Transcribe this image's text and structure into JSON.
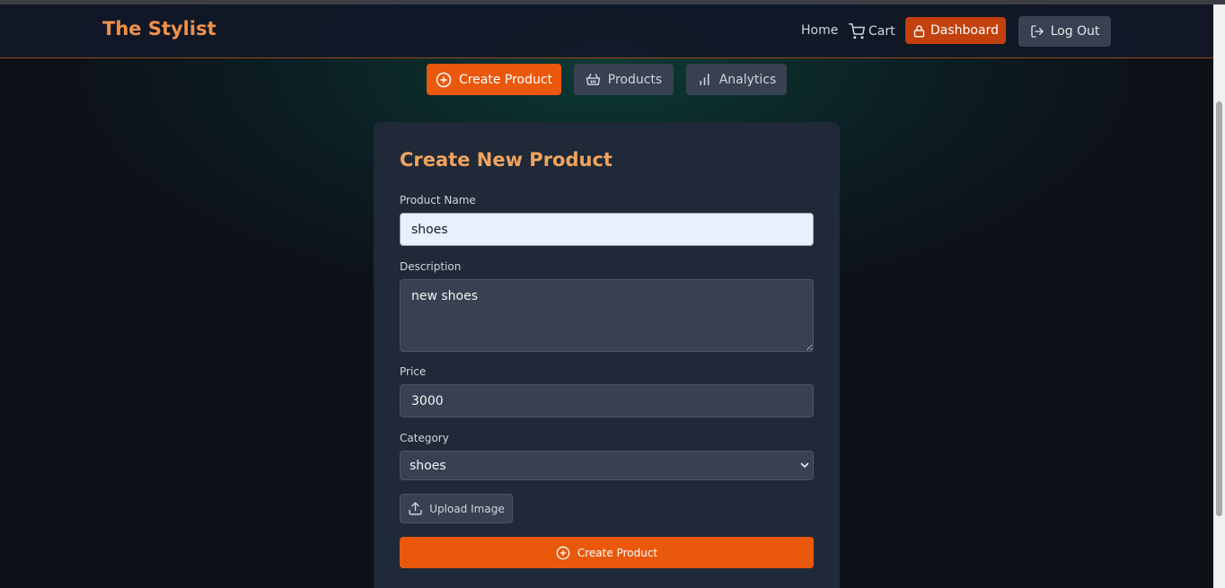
{
  "navbar": {
    "brand": "The Stylist",
    "home": "Home",
    "cart": "Cart",
    "dashboard": "Dashboard",
    "logout": "Log Out"
  },
  "tabs": [
    {
      "label": "Create Product",
      "icon": "plus-circle-icon",
      "active": true
    },
    {
      "label": "Products",
      "icon": "basket-icon",
      "active": false
    },
    {
      "label": "Analytics",
      "icon": "bar-chart-icon",
      "active": false
    }
  ],
  "form": {
    "title": "Create New Product",
    "name_label": "Product Name",
    "name_value": "shoes",
    "description_label": "Description",
    "description_value": "new shoes",
    "price_label": "Price",
    "price_value": "3000",
    "category_label": "Category",
    "category_value": "shoes",
    "upload_label": "Upload Image",
    "submit_label": "Create Product"
  },
  "colors": {
    "accent": "#ea580c",
    "brand": "#f0914a",
    "card": "#1f2937"
  }
}
